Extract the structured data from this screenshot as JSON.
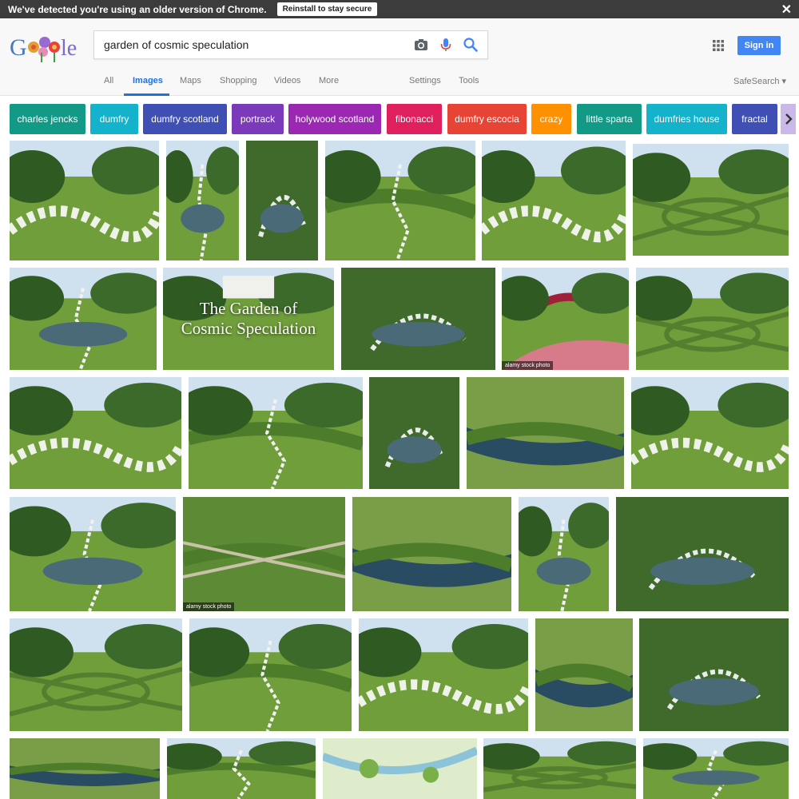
{
  "banner": {
    "message": "We've detected you're using an older version of Chrome.",
    "reinstall_label": "Reinstall to stay secure",
    "close_glyph": "✕"
  },
  "search": {
    "query": "garden of cosmic speculation"
  },
  "header": {
    "signin_label": "Sign in",
    "safesearch_label": "SafeSearch ▾"
  },
  "tabs": [
    "All",
    "Images",
    "Maps",
    "Shopping",
    "Videos",
    "More",
    "Settings",
    "Tools"
  ],
  "chips": [
    {
      "label": "charles jencks",
      "color": "#139a87"
    },
    {
      "label": "dumfry",
      "color": "#14b3cb"
    },
    {
      "label": "dumfry scotland",
      "color": "#3f4fb3"
    },
    {
      "label": "portrack",
      "color": "#7b3aba"
    },
    {
      "label": "holywood scotland",
      "color": "#9a28b3"
    },
    {
      "label": "fibonacci",
      "color": "#e0205c"
    },
    {
      "label": "dumfry escocia",
      "color": "#e84436"
    },
    {
      "label": "crazy",
      "color": "#ff9100"
    },
    {
      "label": "little sparta",
      "color": "#139a87"
    },
    {
      "label": "dumfries house",
      "color": "#14b3cb"
    },
    {
      "label": "fractal",
      "color": "#3f4fb3"
    }
  ],
  "overlay": {
    "title_line1": "The Garden of",
    "title_line2": "Cosmic Speculation",
    "alamy": "alamy stock photo"
  },
  "icons": {
    "camera": "camera-icon",
    "mic": "mic-icon",
    "search": "search-icon",
    "apps": "apps-grid-icon",
    "chevron": "chevron-right-icon",
    "close": "close-icon"
  },
  "colors": {
    "accent": "#1a73e8",
    "signin": "#4285f4",
    "banner": "#3c3c3c"
  }
}
